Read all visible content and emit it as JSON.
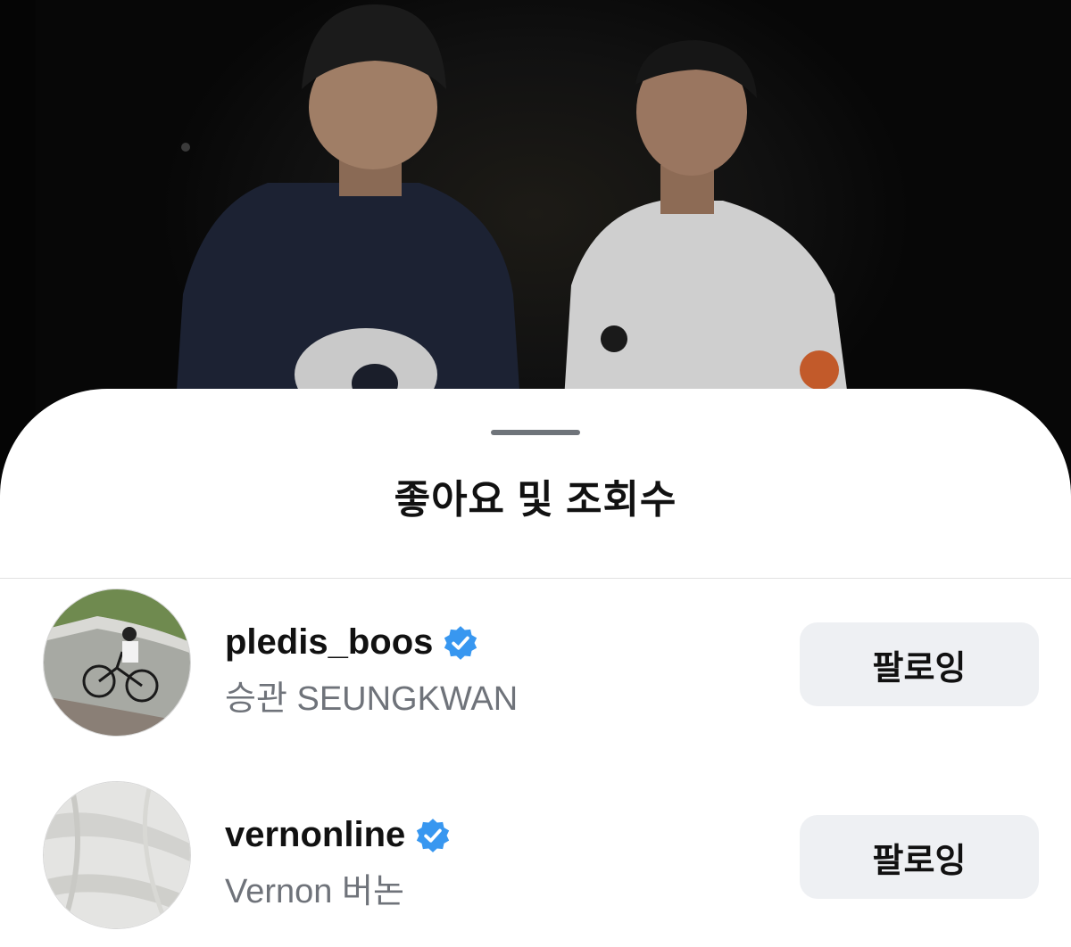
{
  "sheet": {
    "title": "좋아요 및 조회수"
  },
  "users": [
    {
      "username": "pledis_boos",
      "full_name": "승관 SEUNGKWAN",
      "verified": true,
      "follow_label": "팔로잉",
      "avatar": "cyclist-photo"
    },
    {
      "username": "vernonline",
      "full_name": "Vernon 버논",
      "verified": true,
      "follow_label": "팔로잉",
      "avatar": "white-fabric-photo"
    }
  ],
  "colors": {
    "verified_blue": "#3897f0",
    "button_bg": "#eef0f3",
    "secondary_text": "#6f737a"
  }
}
